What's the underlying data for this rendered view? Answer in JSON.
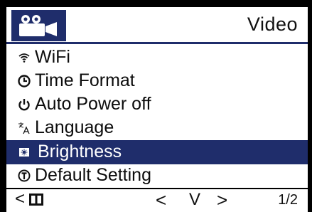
{
  "header": {
    "title": "Video",
    "icon": "video-camera-icon"
  },
  "menu": {
    "items": [
      {
        "label": "WiFi",
        "icon": "wifi-icon",
        "selected": false
      },
      {
        "label": "Time Format",
        "icon": "clock-icon",
        "selected": false
      },
      {
        "label": "Auto Power off",
        "icon": "power-icon",
        "selected": false
      },
      {
        "label": "Language",
        "icon": "language-icon",
        "selected": false
      },
      {
        "label": "Brightness",
        "icon": "brightness-icon",
        "selected": true
      },
      {
        "label": "Default Setting",
        "icon": "reset-icon",
        "selected": false
      }
    ]
  },
  "footer": {
    "back": "<",
    "left": "<",
    "ok": "V",
    "right": ">",
    "page": "1/2"
  },
  "colors": {
    "accent": "#1f2d6b",
    "text": "#111111",
    "background": "#ffffff",
    "bezel": "#000000"
  }
}
